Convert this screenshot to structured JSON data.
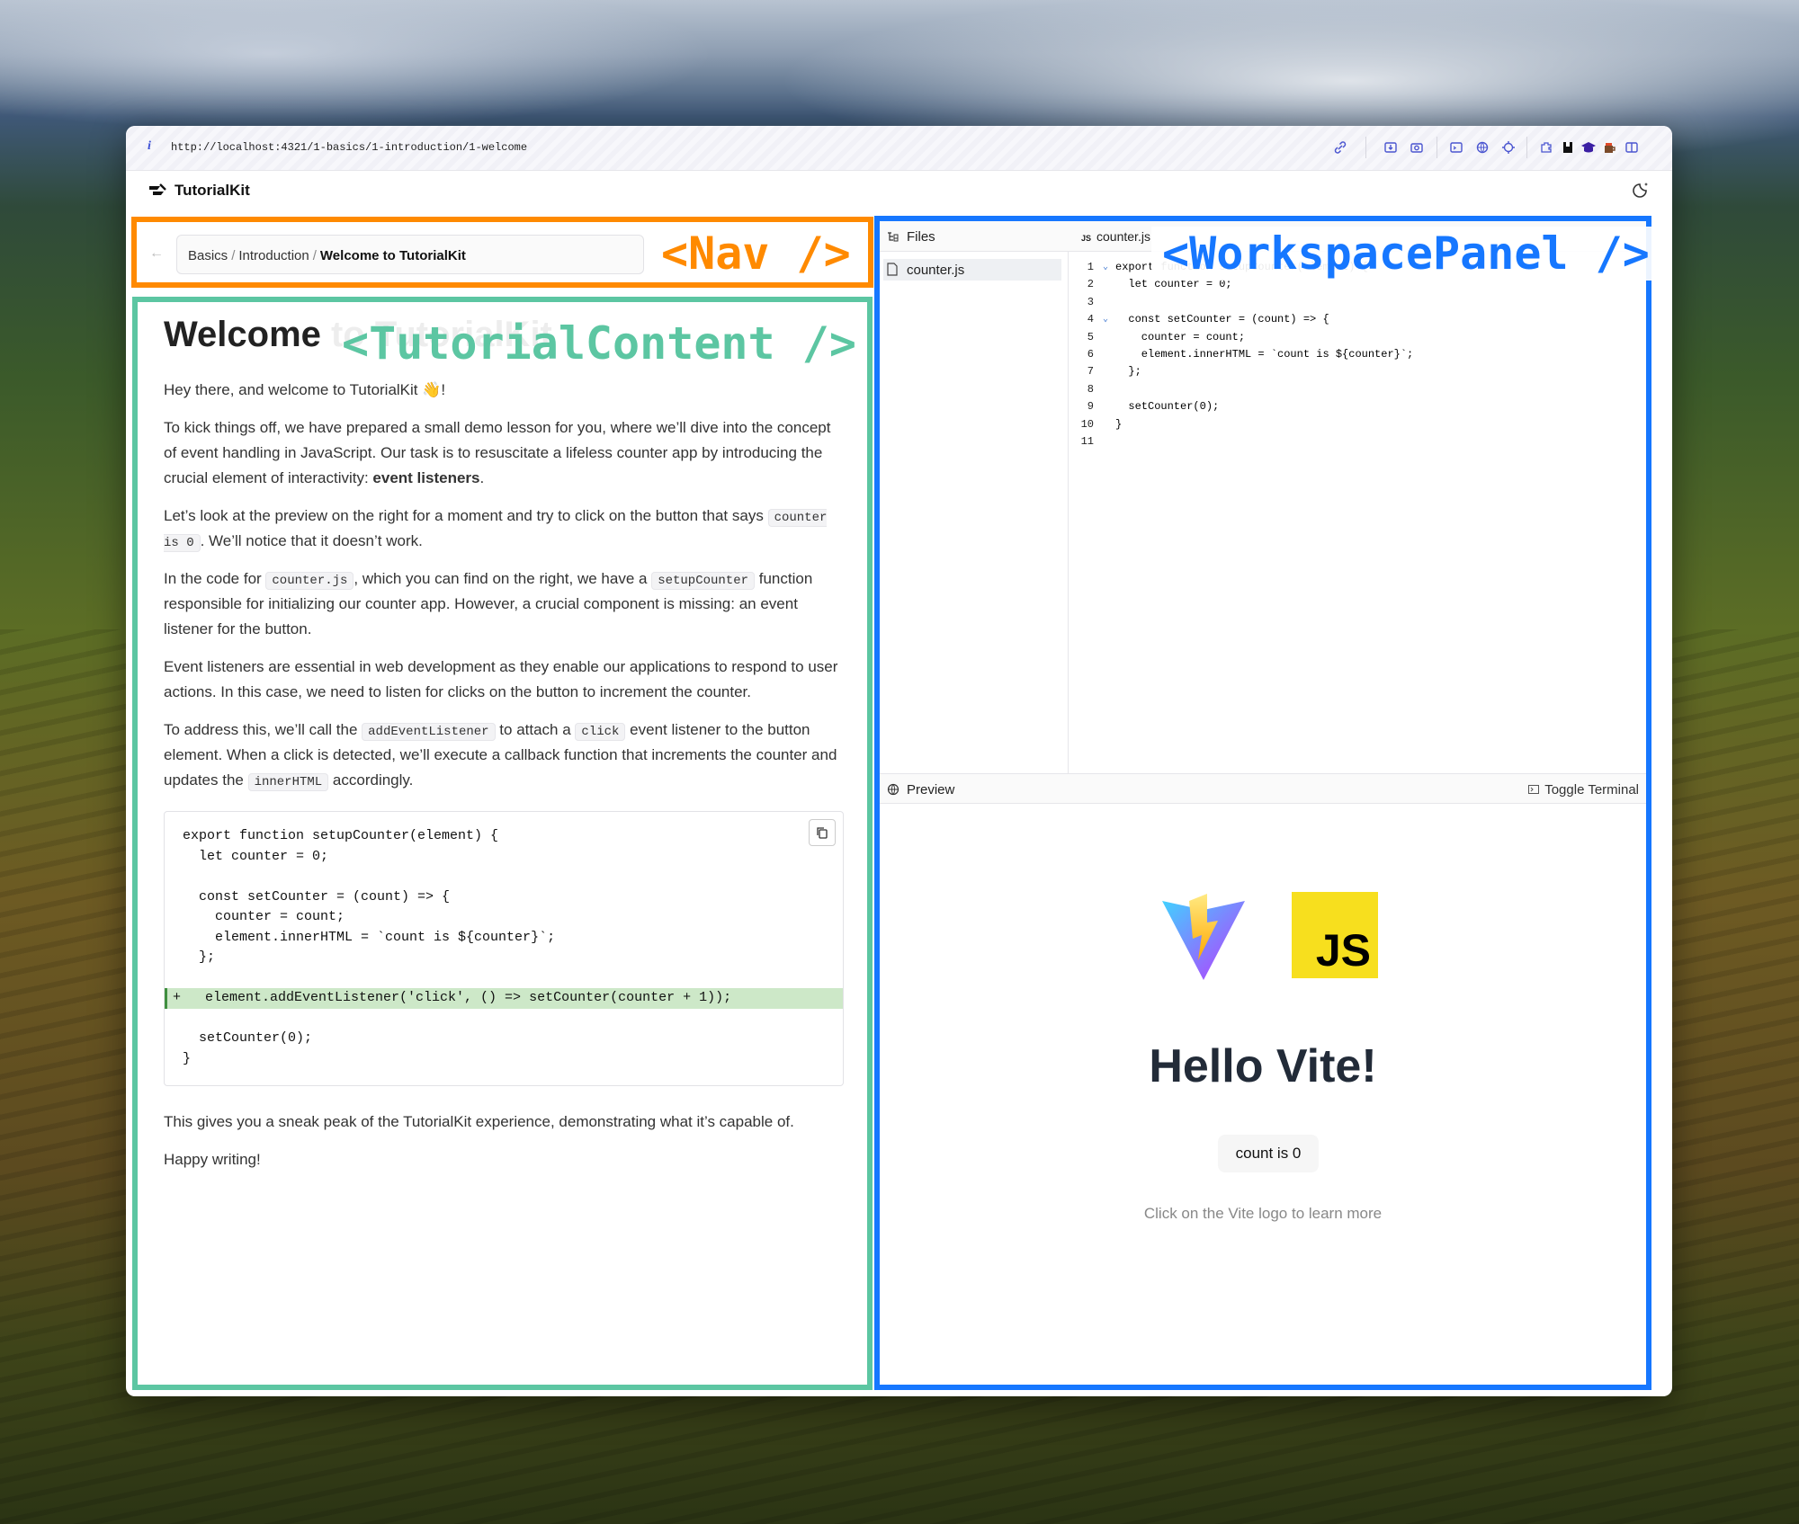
{
  "browser": {
    "info_icon": "i",
    "url": "http://localhost:4321/1-basics/1-introduction/1-welcome"
  },
  "app": {
    "title": "TutorialKit"
  },
  "overlay_tags": {
    "nav": "<Nav />",
    "tutorial_content": "<TutorialContent />",
    "workspace_panel": "<WorkspacePanel />"
  },
  "overlay_colors": {
    "nav": "#ff8a00",
    "tutorial_content": "#5cc6a2",
    "workspace_panel": "#1677ff"
  },
  "nav": {
    "breadcrumb": [
      {
        "label": "Basics"
      },
      {
        "label": "Introduction"
      },
      {
        "label": "Welcome to TutorialKit"
      }
    ]
  },
  "tutorial": {
    "title": "Welcome to TutorialKit",
    "p1": "Hey there, and welcome to TutorialKit 👋!",
    "p2a": "To kick things off, we have prepared a small demo lesson for you, where we’ll dive into the concept of event handling in JavaScript. Our task is to resuscitate a lifeless counter app by introducing the crucial element of interactivity: ",
    "p2b": "event listeners",
    "p2c": ".",
    "p3a": "Let’s look at the preview on the right for a moment and try to click on the button that says ",
    "p3code": "counter is 0",
    "p3b": ". We’ll notice that it doesn’t work.",
    "p4a": "In the code for ",
    "p4code1": "counter.js",
    "p4b": ", which you can find on the right, we have a ",
    "p4code2": "setupCounter",
    "p4c": " function responsible for initializing our counter app. However, a crucial component is missing: an event listener for the button.",
    "p5": "Event listeners are essential in web development as they enable our applications to respond to user actions. In this case, we need to listen for clicks on the button to increment the counter.",
    "p6a": "To address this, we’ll call the ",
    "p6code1": "addEventListener",
    "p6b": " to attach a ",
    "p6code2": "click",
    "p6c": " event listener to the button element. When a click is detected, we’ll execute a callback function that increments the counter and updates the ",
    "p6code3": "innerHTML",
    "p6d": " accordingly.",
    "p7": "This gives you a sneak peak of the TutorialKit experience, demonstrating what it’s capable of.",
    "p8": "Happy writing!"
  },
  "codeblock": {
    "lines": [
      "export function setupCounter(element) {",
      "  let counter = 0;",
      "",
      "  const setCounter = (count) => {",
      "    counter = count;",
      "    element.innerHTML = `count is ${counter}`;",
      "  };",
      "",
      "+   element.addEventListener('click', () => setCounter(counter + 1));",
      "",
      "  setCounter(0);",
      "}"
    ]
  },
  "workspace": {
    "files_label": "Files",
    "file_name": "counter.js",
    "tab_label": "counter.js",
    "editor_lines": [
      {
        "num": "1",
        "fold": true,
        "text": "export function setupCounter(element) {"
      },
      {
        "num": "2",
        "fold": false,
        "text": "  let counter = 0;"
      },
      {
        "num": "3",
        "fold": false,
        "text": ""
      },
      {
        "num": "4",
        "fold": true,
        "text": "  const setCounter = (count) => {"
      },
      {
        "num": "5",
        "fold": false,
        "text": "    counter = count;"
      },
      {
        "num": "6",
        "fold": false,
        "text": "    element.innerHTML = `count is ${counter}`;"
      },
      {
        "num": "7",
        "fold": false,
        "text": "  };"
      },
      {
        "num": "8",
        "fold": false,
        "text": ""
      },
      {
        "num": "9",
        "fold": false,
        "text": "  setCounter(0);"
      },
      {
        "num": "10",
        "fold": false,
        "text": "}"
      },
      {
        "num": "11",
        "fold": false,
        "text": ""
      }
    ],
    "preview_label": "Preview",
    "toggle_terminal": "Toggle Terminal"
  },
  "preview": {
    "js_logo": "JS",
    "heading": "Hello Vite!",
    "button": "count is 0",
    "hint": "Click on the Vite logo to learn more"
  }
}
